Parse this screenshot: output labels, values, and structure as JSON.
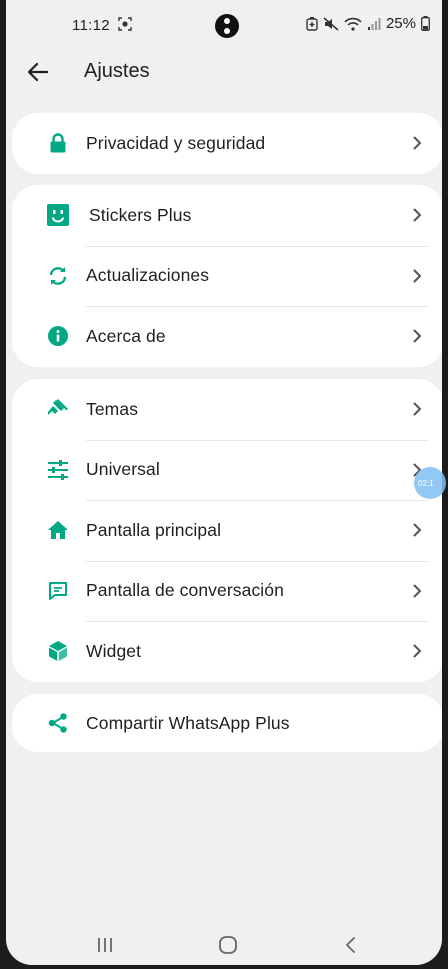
{
  "status_bar": {
    "time": "11:12",
    "battery": "25%"
  },
  "app_bar": {
    "title": "Ajustes"
  },
  "colors": {
    "accent": "#00a884",
    "background": "#f0f0f0",
    "card": "#ffffff",
    "text": "#1f1f1f"
  },
  "groups": [
    {
      "items": [
        {
          "label": "Privacidad y seguridad",
          "icon": "lock-icon"
        }
      ]
    },
    {
      "items": [
        {
          "label": "Stickers Plus",
          "icon": "sticker-icon"
        },
        {
          "label": "Actualizaciones",
          "icon": "refresh-icon"
        },
        {
          "label": "Acerca de",
          "icon": "info-icon"
        }
      ]
    },
    {
      "items": [
        {
          "label": "Temas",
          "icon": "brush-icon"
        },
        {
          "label": "Universal",
          "icon": "sliders-icon"
        },
        {
          "label": "Pantalla principal",
          "icon": "home-icon"
        },
        {
          "label": "Pantalla de conversación",
          "icon": "chat-icon"
        },
        {
          "label": "Widget",
          "icon": "cube-icon"
        }
      ]
    },
    {
      "items": [
        {
          "label": "Compartir WhatsApp Plus",
          "icon": "share-icon"
        }
      ]
    }
  ],
  "floating_bubble": {
    "text": "02:1"
  },
  "nav_bar": {
    "buttons": [
      "recents-icon",
      "home-nav-icon",
      "back-nav-icon"
    ]
  }
}
